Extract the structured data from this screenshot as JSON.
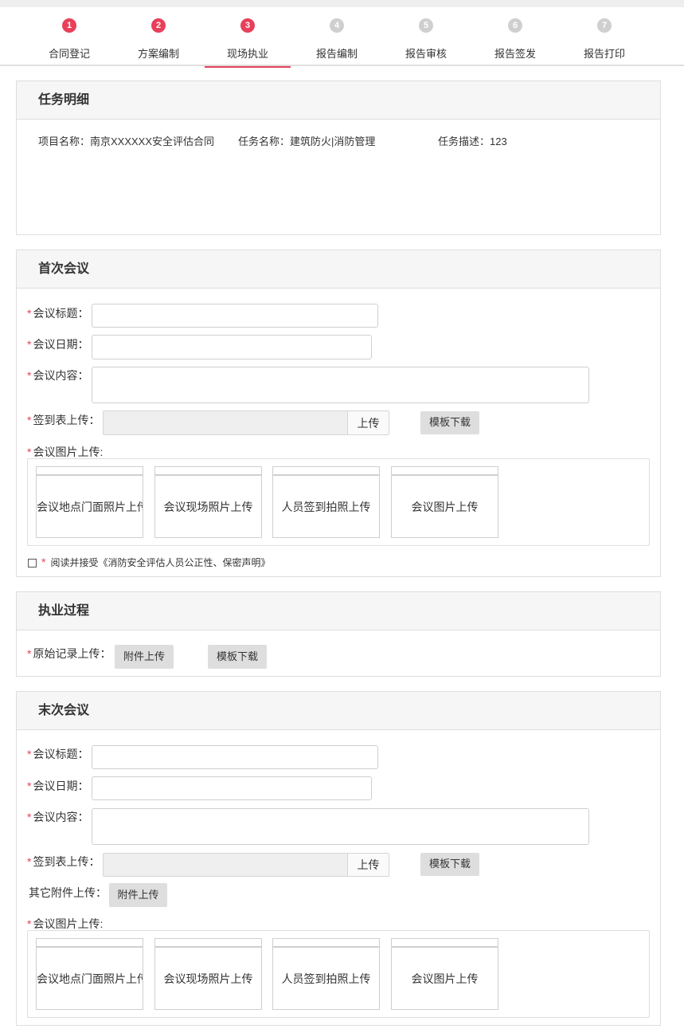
{
  "steps": [
    {
      "num": "1",
      "label": "合同登记",
      "state": "done"
    },
    {
      "num": "2",
      "label": "方案编制",
      "state": "done"
    },
    {
      "num": "3",
      "label": "现场执业",
      "state": "current"
    },
    {
      "num": "4",
      "label": "报告编制",
      "state": "todo"
    },
    {
      "num": "5",
      "label": "报告审核",
      "state": "todo"
    },
    {
      "num": "6",
      "label": "报告签发",
      "state": "todo"
    },
    {
      "num": "7",
      "label": "报告打印",
      "state": "todo"
    }
  ],
  "task": {
    "title": "任务明细",
    "project_name": "项目名称：南京XXXXXX安全评估合同",
    "task_name": "任务名称：建筑防火|消防管理",
    "task_desc": "任务描述：123"
  },
  "first_meeting": {
    "title": "首次会议",
    "req": "*",
    "meeting_title_label": "会议标题：",
    "meeting_date_label": "会议日期：",
    "meeting_content_label": "会议内容：",
    "signin_label": "签到表上传：",
    "upload_label": "上传",
    "template_label": "模板下载",
    "photos_label": "会议图片上传:",
    "photos": [
      "会议地点门面照片上传",
      "会议现场照片上传",
      "人员签到拍照上传",
      "会议图片上传"
    ],
    "agree_text": "阅读并接受《消防安全评估人员公正性、保密声明》"
  },
  "process": {
    "title": "执业过程",
    "raw_label": "原始记录上传：",
    "attach_label": "附件上传",
    "template_label": "模板下载"
  },
  "last_meeting": {
    "title": "末次会议",
    "req": "*",
    "meeting_title_label": "会议标题：",
    "meeting_date_label": "会议日期：",
    "meeting_content_label": "会议内容：",
    "signin_label": "签到表上传：",
    "upload_label": "上传",
    "template_label": "模板下载",
    "other_label": "其它附件上传：",
    "attach_label": "附件上传",
    "photos_label": "会议图片上传:",
    "photos": [
      "会议地点门面照片上传",
      "会议现场照片上传",
      "人员签到拍照上传",
      "会议图片上传"
    ]
  },
  "colors": {
    "accent": "#e8405a",
    "inactive": "#cfcfcf"
  }
}
